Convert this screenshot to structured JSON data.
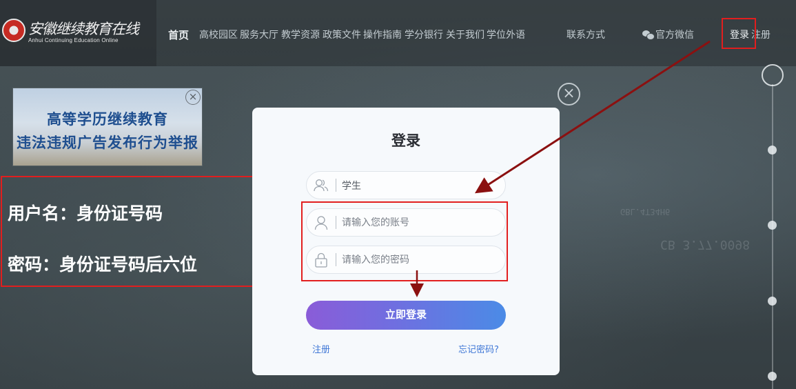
{
  "nav": {
    "logo_cn": "安徽继续教育在线",
    "logo_en": "Anhui Continuing Education Online",
    "home": "首页",
    "items": [
      "高校园区",
      "服务大厅",
      "教学资源",
      "政策文件",
      "操作指南",
      "学分银行",
      "关于我们",
      "学位外语"
    ],
    "contact": "联系方式",
    "wechat": "官方微信",
    "login": "登录",
    "register": "注册"
  },
  "ad": {
    "line1": "高等学历继续教育",
    "line2": "违法违规广告发布行为举报",
    "close": "×"
  },
  "note": {
    "username": "用户名：身份证号码",
    "password": "密码：身份证号码后六位"
  },
  "modal": {
    "title": "登录",
    "role_value": "学生",
    "account_placeholder": "请输入您的账号",
    "password_placeholder": "请输入您的密码",
    "submit": "立即登录",
    "register_link": "注册",
    "forgot_link": "忘记密码?",
    "close": "×"
  },
  "background": {
    "deco1": "CB 3.77.0098",
    "deco2": "GBL.4T34H6"
  },
  "colors": {
    "highlight_red": "#e21e1e",
    "button_start": "#8a5cd8",
    "button_end": "#4b8be6",
    "link_blue": "#3f77d6"
  },
  "icons": {
    "role": "users-icon",
    "account": "user-icon",
    "password": "lock-icon",
    "wechat": "wechat-icon"
  }
}
